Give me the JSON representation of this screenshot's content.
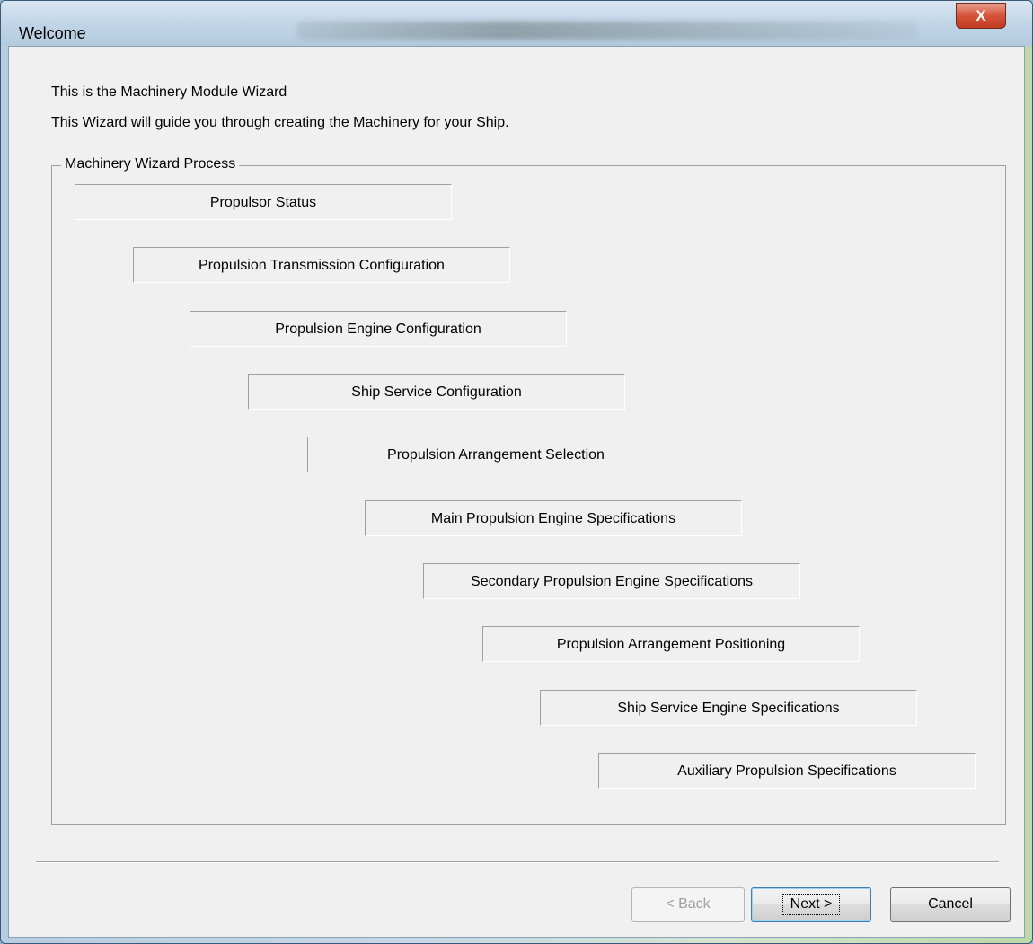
{
  "window": {
    "title": "Welcome",
    "close_glyph": "X"
  },
  "intro": {
    "line1": "This is the Machinery Module Wizard",
    "line2": "This Wizard will guide you through creating the Machinery for your Ship."
  },
  "process": {
    "legend": "Machinery Wizard Process",
    "steps": [
      "Propulsor Status",
      "Propulsion Transmission Configuration",
      "Propulsion Engine Configuration",
      "Ship Service Configuration",
      "Propulsion Arrangement Selection",
      "Main Propulsion Engine Specifications",
      "Secondary Propulsion Engine Specifications",
      "Propulsion Arrangement Positioning",
      "Ship Service Engine Specifications",
      "Auxiliary Propulsion Specifications"
    ]
  },
  "buttons": {
    "back": "< Back",
    "next": "Next >",
    "cancel": "Cancel"
  }
}
